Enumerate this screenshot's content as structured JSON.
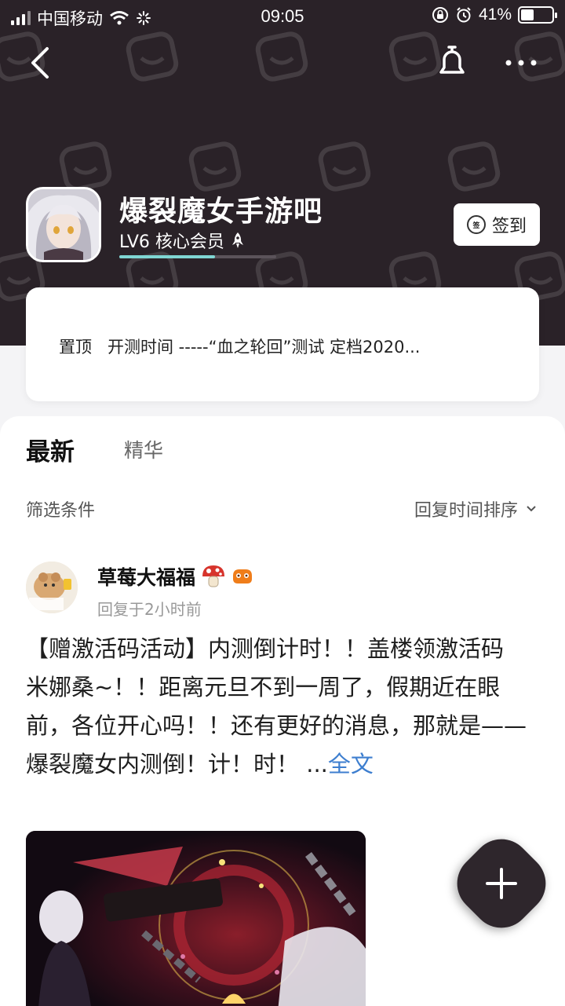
{
  "status_bar": {
    "carrier": "中国移动",
    "time": "09:05",
    "battery": "41%",
    "battery_level": 0.41
  },
  "forum": {
    "name": "爆裂魔女手游吧",
    "member_level": "LV6 核心会员",
    "level_progress": 0.61,
    "signin_label": "签到",
    "signin_icon_text": "签"
  },
  "pinned": {
    "tag": "置顶",
    "text": "开测时间 -----“血之轮回”测试 定档2020..."
  },
  "tabs": {
    "latest": "最新",
    "featured": "精华"
  },
  "filter": {
    "label": "筛选条件",
    "sort": "回复时间排序"
  },
  "post": {
    "author": "草莓大福福",
    "time": "回复于2小时前",
    "body_line1": "【赠激活码活动】内测倒计时！！盖楼领激活码",
    "body_line2": "米娜桑~！！距离元旦不到一周了，假期近在眼前，各位开心吗！！还有更好的消息，那就是—— 爆裂魔女内测倒！计！时！",
    "ellipsis": "...",
    "read_more": "全文"
  },
  "icons": {
    "back": "back-arrow-icon",
    "bell": "bell-icon",
    "more": "more-icon",
    "add": "plus-icon"
  },
  "colors": {
    "header_bg": "#2a2228",
    "accent_teal": "#7fd6d3",
    "link_blue": "#3d7ecf"
  }
}
